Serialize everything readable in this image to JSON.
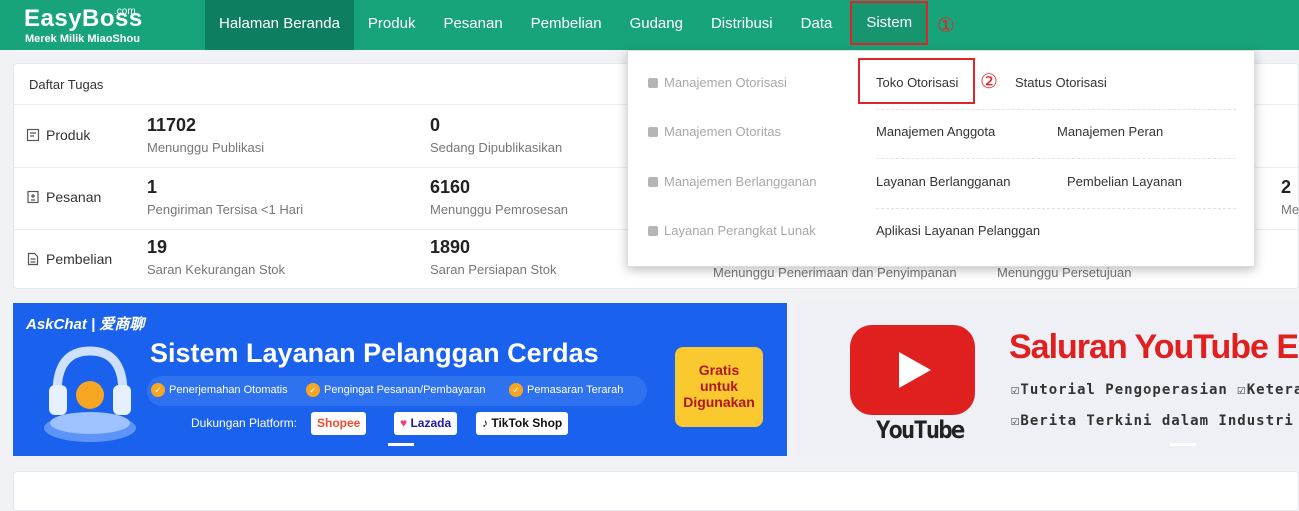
{
  "header": {
    "brand": "EasyBoss",
    "brand_suffix": ".com",
    "brand_sub": "Merek Milik MiaoShou",
    "nav": [
      "Halaman Beranda",
      "Produk",
      "Pesanan",
      "Pembelian",
      "Gudang",
      "Distribusi",
      "Data",
      "Sistem"
    ],
    "annotation_1": "①"
  },
  "tasks": {
    "title": "Daftar Tugas",
    "rows": [
      {
        "label": "Produk",
        "stats": [
          {
            "num": "11702",
            "lbl": "Menunggu Publikasi"
          },
          {
            "num": "0",
            "lbl": "Sedang Dipublikasikan"
          }
        ]
      },
      {
        "label": "Pesanan",
        "stats": [
          {
            "num": "1",
            "lbl": "Pengiriman Tersisa <1 Hari"
          },
          {
            "num": "6160",
            "lbl": "Menunggu Pemrosesan"
          }
        ],
        "right_num": "2",
        "right_lbl": "Me"
      },
      {
        "label": "Pembelian",
        "stats": [
          {
            "num": "19",
            "lbl": "Saran Kekurangan Stok"
          },
          {
            "num": "1890",
            "lbl": "Saran Persiapan Stok"
          }
        ],
        "hidden_lbls": [
          "Menunggu Penerimaan dan Penyimpanan",
          "Menunggu Persetujuan"
        ]
      }
    ]
  },
  "dropdown": {
    "categories": [
      "Manajemen Otorisasi",
      "Manajemen Otoritas",
      "Manajemen Berlangganan",
      "Layanan Perangkat Lunak"
    ],
    "links": {
      "toko_otorisasi": "Toko Otorisasi",
      "status_otorisasi": "Status Otorisasi",
      "manajemen_anggota": "Manajemen Anggota",
      "manajemen_peran": "Manajemen Peran",
      "layanan_berlangganan": "Layanan Berlangganan",
      "pembelian_layanan": "Pembelian Layanan",
      "aplikasi_layanan": "Aplikasi Layanan Pelanggan"
    },
    "annotation_2": "②"
  },
  "banner1": {
    "logo": "AskChat | 爱商聊",
    "title": "Sistem Layanan Pelanggan Cerdas",
    "features": [
      "Penerjemahan Otomatis",
      "Pengingat Pesanan/Pembayaran",
      "Pemasaran Terarah"
    ],
    "platform_label": "Dukungan Platform:",
    "platforms": [
      "Shopee",
      "Lazada",
      "TikTok Shop"
    ],
    "cta": [
      "Gratis",
      "untuk",
      "Digunakan"
    ]
  },
  "banner2": {
    "yt_word": "YouTube",
    "title": "Saluran YouTube Eas",
    "line1": "☑Tutorial Pengoperasian ☑Keteramp",
    "line2": "☑Berita Terkini dalam Industri E-comm"
  },
  "colors": {
    "brand": "#18a47b",
    "active_nav": "#0e7e60",
    "annotation": "#e0242a",
    "banner_blue": "#1a62ee",
    "youtube_red": "#e0201f"
  }
}
